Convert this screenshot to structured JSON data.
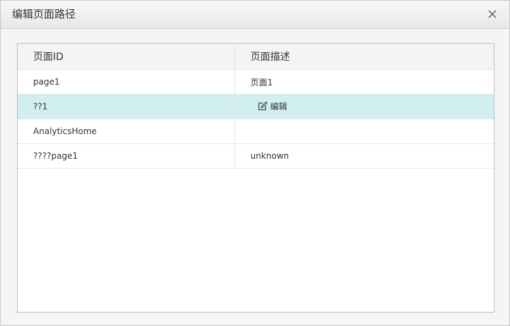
{
  "dialog": {
    "title": "编辑页面路径",
    "close_icon": "close-icon"
  },
  "table": {
    "columns": [
      "页面ID",
      "页面描述"
    ],
    "rows": [
      {
        "id": "page1",
        "desc": "页面1"
      },
      {
        "id": "??1",
        "desc": "",
        "action": "编辑",
        "action_icon": "edit-icon",
        "selected": true
      },
      {
        "id": "AnalyticsHome",
        "desc": ""
      },
      {
        "id": "????page1",
        "desc": "unknown"
      }
    ]
  },
  "colors": {
    "selected_row": "#d1efef",
    "header_bg": "#f4f4f4",
    "dialog_bg": "#f5f5f5"
  }
}
